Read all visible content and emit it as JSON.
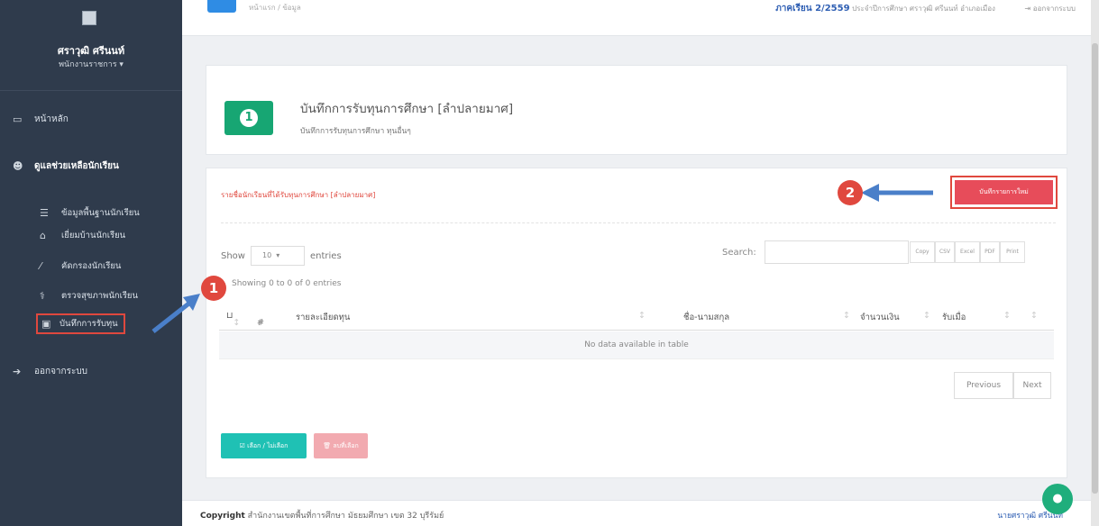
{
  "sidebar": {
    "user_name": "ศราวุฒิ ศรีนนท์",
    "user_role": "พนักงานราชการ ▾",
    "items": [
      {
        "icon": "id-card-icon",
        "glyph": "▭",
        "label": "หน้าหลัก"
      },
      {
        "icon": "students-icon",
        "glyph": "☻",
        "label": "ดูแลช่วยเหลือนักเรียน"
      },
      {
        "icon": "database-icon",
        "glyph": "☰",
        "label": "ข้อมูลพื้นฐานนักเรียน"
      },
      {
        "icon": "home-icon",
        "glyph": "⌂",
        "label": "เยี่ยมบ้านนักเรียน"
      },
      {
        "icon": "magic-wand-icon",
        "glyph": "⁄",
        "label": "คัดกรองนักเรียน"
      },
      {
        "icon": "stethoscope-icon",
        "glyph": "⚕",
        "label": "ตรวจสุขภาพนักเรียน"
      },
      {
        "icon": "money-icon",
        "glyph": "▣",
        "label": "บันทึกการรับทุน"
      },
      {
        "icon": "sign-out-icon",
        "glyph": "➔",
        "label": "ออกจากระบบ"
      }
    ]
  },
  "topbar": {
    "breadcrumb": "หน้าแรก / ข้อมูล",
    "term": "ภาคเรียน 2/2559",
    "school_info": "ประจำปีการศึกษา ศราวุฒิ ศรีนนท์ อำเภอเมือง",
    "logout": "⇥ ออกจากระบบ"
  },
  "header_card": {
    "icon_glyph": "1",
    "title": "บันทึกการรับทุนการศึกษา [ลำปลายมาศ]",
    "subtitle": "บันทึกการรับทุนการศึกษา ทุนอื่นๆ"
  },
  "list_card": {
    "title": "รายชื่อนักเรียนที่ได้รับทุนการศึกษา [ลำปลายมาศ]",
    "new_button": "บันทึกรายการใหม่",
    "show_label": "Show",
    "entries_value": "10",
    "entries_label": "entries",
    "search_label": "Search:",
    "search_value": "",
    "export_buttons": [
      "Copy",
      "CSV",
      "Excel",
      "PDF",
      "Print"
    ],
    "info": "Showing 0 to 0 of 0 entries",
    "columns": [
      "#",
      "รายละเอียดทุน",
      "ชื่อ-นามสกุล",
      "จำนวนเงิน",
      "รับเมื่อ"
    ],
    "no_data": "No data available in table",
    "prev": "Previous",
    "next": "Next",
    "select_button": "☑ เลือก / ไม่เลือก",
    "delete_button": "🗑 ลบที่เลือก"
  },
  "annotations": {
    "marker1": "1",
    "marker2": "2",
    "accent": "#e0483e",
    "arrow": "#4a7fc9"
  },
  "footer": {
    "copyright_label": "Copyright",
    "copyright_text": " สำนักงานเขตพื้นที่การศึกษา มัธยมศึกษา เขต 32 บุรีรัมย์",
    "right_text": "นายศราวุฒิ ศรีนนท์"
  }
}
